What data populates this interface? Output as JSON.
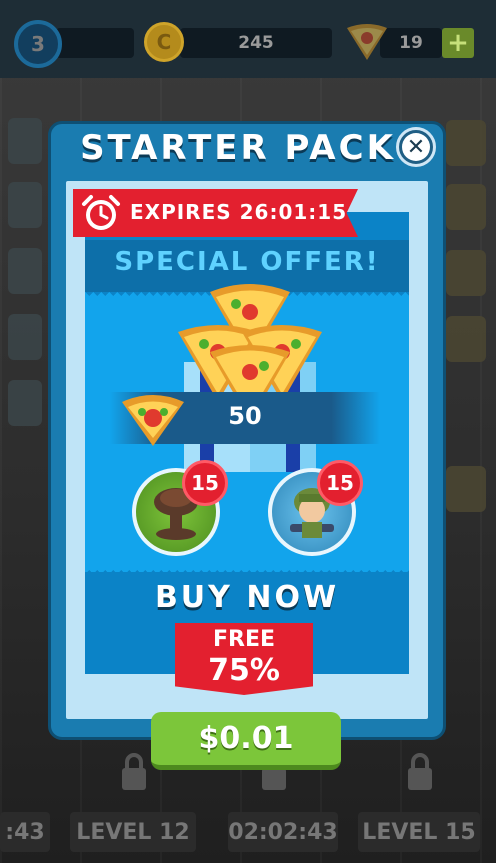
{
  "hud": {
    "level": "3",
    "coins": "245",
    "pizza_slices": "19",
    "plus_label": "+"
  },
  "dialog": {
    "title": "STARTER PACK",
    "close_icon": "close-icon",
    "timer_label": "EXPIRES",
    "timer_value": "26:01:15",
    "special_offer": "SPECIAL OFFER!",
    "pizza_amount": "50",
    "items": [
      {
        "name": "nuke",
        "count": "15",
        "icon": "mushroom-cloud-icon"
      },
      {
        "name": "soldier",
        "count": "15",
        "icon": "soldier-icon"
      }
    ],
    "buy_now": "BUY NOW",
    "free_label": "FREE",
    "free_percent": "75%",
    "price": "$0.01"
  },
  "background": {
    "bottom_labels": [
      "LEVEL 12",
      "02:02:43",
      "LEVEL 15"
    ],
    "left_partial": ":43"
  },
  "colors": {
    "dialog_blue": "#1a7cb0",
    "accent_red": "#e3202f",
    "buy_green": "#7cc63a",
    "panel_light": "#bfe4f7"
  }
}
